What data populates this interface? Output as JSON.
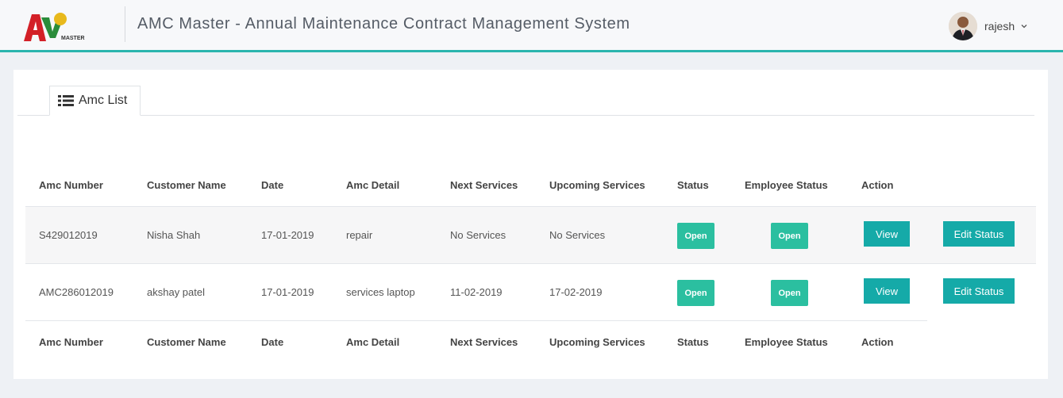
{
  "header": {
    "title": "AMC Master - Annual Maintenance Contract Management System",
    "logo_text": "MASTER",
    "user_name": "rajesh"
  },
  "tab": {
    "label": "Amc List",
    "icon": "list-icon"
  },
  "table": {
    "columns": [
      "Amc Number",
      "Customer Name",
      "Date",
      "Amc Detail",
      "Next Services",
      "Upcoming Services",
      "Status",
      "Employee Status",
      "Action"
    ],
    "rows": [
      {
        "amc_number": "S429012019",
        "customer_name": "Nisha Shah",
        "date": "17-01-2019",
        "amc_detail": "repair",
        "next_services": "No Services",
        "upcoming_services": "No Services",
        "status": "Open",
        "employee_status": "Open",
        "view_label": "View",
        "edit_label": "Edit Status"
      },
      {
        "amc_number": "AMC286012019",
        "customer_name": "akshay patel",
        "date": "17-01-2019",
        "amc_detail": "services laptop",
        "next_services": "11-02-2019",
        "upcoming_services": "17-02-2019",
        "status": "Open",
        "employee_status": "Open",
        "view_label": "View",
        "edit_label": "Edit Status"
      }
    ]
  },
  "colors": {
    "accent": "#2bb5ae",
    "status_badge": "#2bbfa0",
    "button": "#15aaa8"
  }
}
